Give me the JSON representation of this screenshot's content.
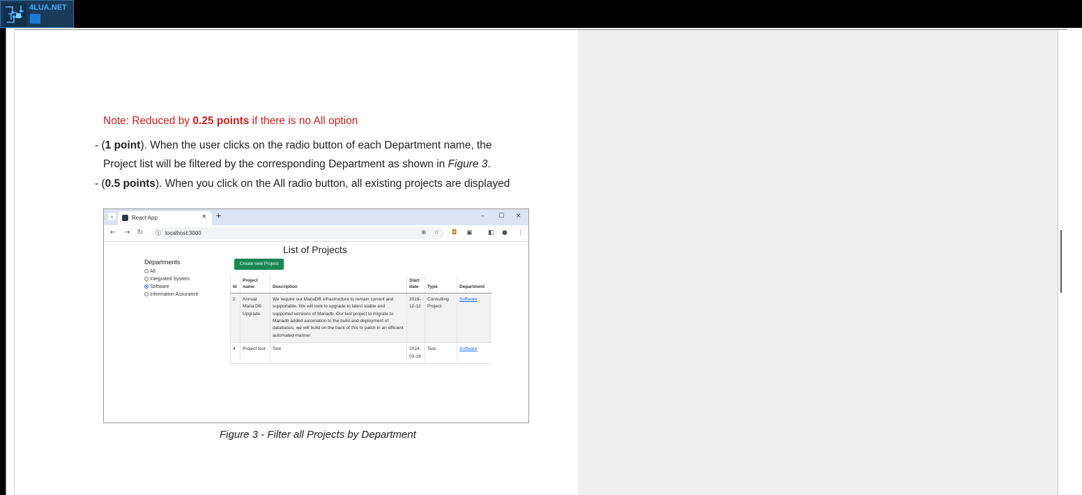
{
  "site_logo": {
    "text": "4LUA.NET"
  },
  "doc": {
    "note_prefix": "Note: Reduced by ",
    "note_bold": "0.25 points",
    "note_suffix": " if there is no All option",
    "b1_pre": "- (",
    "b1_bold": "1 point",
    "b1_text": "). When the user clicks on the radio button of each Department name, the",
    "b1_line2_pre": "Project list will be filtered by the corresponding Department as shown in ",
    "b1_line2_ital": "Figure 3",
    "b1_line2_end": ".",
    "b2_pre": "- (",
    "b2_bold": "0.5 points",
    "b2_text": "). When you click on the All radio button, all existing projects are displayed",
    "caption": "Figure 3 - Filter all Projects by Department"
  },
  "browser": {
    "tab_title": "React App",
    "tab_close": "×",
    "new_tab": "+",
    "url": "localhost:3000",
    "win_min": "–",
    "win_max": "☐",
    "win_close": "×"
  },
  "app": {
    "title": "List of Projects",
    "departments_heading": "Departments",
    "departments": [
      {
        "label": "All",
        "selected": false
      },
      {
        "label": "Integrated System",
        "selected": false
      },
      {
        "label": "Software",
        "selected": true
      },
      {
        "label": "Information Assurance",
        "selected": false
      }
    ],
    "create_button": "Create new Project",
    "table": {
      "headers": [
        "Id",
        "Project name",
        "Description",
        "Start date",
        "Type",
        "Department"
      ],
      "rows": [
        {
          "id": "2",
          "name": "Annual Maria DB Upgrade",
          "description": "We require our MariaDB infrastructure to remain current and supportable. We will look to upgrade to latest stable and supported versions of Mariadb. Our last project to migrate to Mariadb added automation to the build and deployment of databases, we will build on the back of this to patch in an efficient automated manner.",
          "start_date": "2019-12-12",
          "type": "Consulting Project",
          "department": "Software"
        },
        {
          "id": "4",
          "name": "Project test",
          "description": "Test",
          "start_date": "2024-03-16",
          "type": "Test",
          "department": "Software"
        }
      ]
    }
  }
}
